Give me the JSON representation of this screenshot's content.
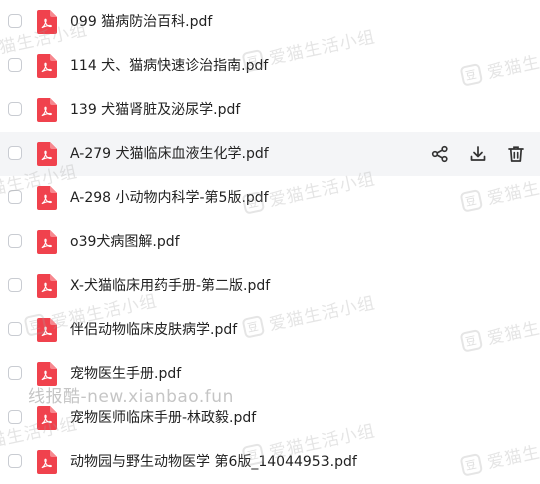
{
  "files": [
    {
      "name": "099 猫病防治百科.pdf"
    },
    {
      "name": "114 犬、猫病快速诊治指南.pdf"
    },
    {
      "name": "139 犬猫肾脏及泌尿学.pdf"
    },
    {
      "name": "A-279 犬猫临床血液生化学.pdf",
      "highlighted": true
    },
    {
      "name": "A-298 小动物内科学-第5版.pdf"
    },
    {
      "name": "o39犬病图解.pdf"
    },
    {
      "name": "X-犬猫临床用药手册-第二版.pdf"
    },
    {
      "name": "伴侣动物临床皮肤病学.pdf"
    },
    {
      "name": "宠物医生手册.pdf"
    },
    {
      "name": "宠物医师临床手册-林政毅.pdf"
    },
    {
      "name": "动物园与野生动物医学 第6版_14044953.pdf"
    }
  ],
  "actions": {
    "share_icon": "share-icon",
    "download_icon": "download-icon",
    "delete_icon": "trash-icon"
  },
  "watermark": {
    "text": "爱猫生活小组",
    "badge": "豆",
    "url_text": "线报酷-new.xianbao.fun"
  },
  "colors": {
    "pdf_red": "#f0424d",
    "row_highlight": "#f4f5f7",
    "icon_dark": "#333333"
  }
}
